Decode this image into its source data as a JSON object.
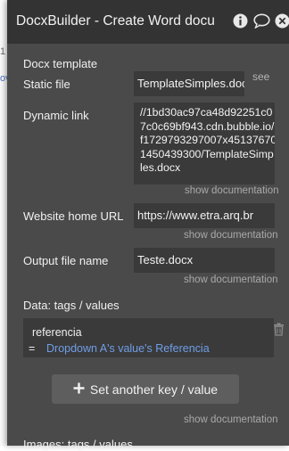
{
  "window": {
    "title": "DocxBuilder - Create Word docu"
  },
  "background": {
    "tick": "1",
    "link_glyph": "ov"
  },
  "sections": {
    "docx_template": "Docx template",
    "data_tags": "Data: tags / values",
    "images_tags": "Images: tags / values"
  },
  "fields": {
    "static_file": {
      "label": "Static file",
      "value": "TemplateSimples.docx",
      "aside": "see"
    },
    "dynamic_link": {
      "label": "Dynamic link",
      "lines": [
        "//1bd30ac97ca48d92251c0",
        "7c0c69bf943.cdn.bubble.io/",
        "f1729793297007x45137670",
        "1450439300/TemplateSimp",
        "les.docx"
      ]
    },
    "website_home_url": {
      "label": "Website home URL",
      "value": "https://www.etra.arq.br"
    },
    "output_file_name": {
      "label": "Output file name",
      "value": "Teste.docx"
    }
  },
  "docs": {
    "show_documentation": "show documentation"
  },
  "tags_row": {
    "key": "referencia",
    "equals": "=",
    "value": "Dropdown A's value's Referencia"
  },
  "add_button": {
    "label": "Set another key / value"
  },
  "colors": {
    "panel": "#4a4a4a",
    "titlebar": "#333333",
    "field": "#3a3a3a",
    "link": "#6f9ee8"
  }
}
